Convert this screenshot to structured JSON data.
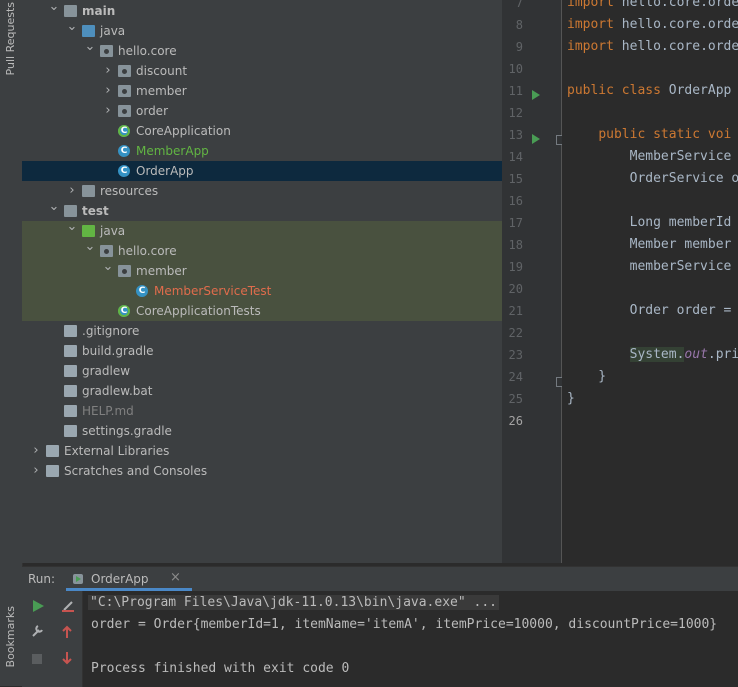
{
  "side_tabs": {
    "pull_requests": "Pull Requests",
    "bookmarks": "Bookmarks"
  },
  "tree": [
    {
      "label": "main",
      "icon": "folder-icon",
      "level": 2,
      "expanded": true,
      "style": "bold"
    },
    {
      "label": "java",
      "icon": "source-folder-icon",
      "level": 3,
      "expanded": true
    },
    {
      "label": "hello.core",
      "icon": "package-icon",
      "level": 4,
      "expanded": true
    },
    {
      "label": "discount",
      "icon": "package-icon",
      "level": 5,
      "expanded": false
    },
    {
      "label": "member",
      "icon": "package-icon",
      "level": 5,
      "expanded": false
    },
    {
      "label": "order",
      "icon": "package-icon",
      "level": 5,
      "expanded": false
    },
    {
      "label": "CoreApplication",
      "icon": "spring-class-icon",
      "level": 5
    },
    {
      "label": "MemberApp",
      "icon": "class-icon",
      "level": 5,
      "color": "#62b543"
    },
    {
      "label": "OrderApp",
      "icon": "class-icon",
      "level": 5,
      "selected": true
    },
    {
      "label": "resources",
      "icon": "resources-folder-icon",
      "level": 3,
      "expanded": false
    },
    {
      "label": "test",
      "icon": "folder-icon",
      "level": 2,
      "expanded": true,
      "style": "bold"
    },
    {
      "label": "java",
      "icon": "test-source-folder-icon",
      "level": 3,
      "expanded": true,
      "test": true
    },
    {
      "label": "hello.core",
      "icon": "package-icon",
      "level": 4,
      "expanded": true,
      "test": true
    },
    {
      "label": "member",
      "icon": "package-icon",
      "level": 5,
      "expanded": true,
      "test": true
    },
    {
      "label": "MemberServiceTest",
      "icon": "test-class-icon",
      "level": 6,
      "color": "#e06c4c",
      "test": true
    },
    {
      "label": "CoreApplicationTests",
      "icon": "spring-class-icon",
      "level": 5,
      "test": true
    },
    {
      "label": ".gitignore",
      "icon": "gitignore-file-icon",
      "level": 2
    },
    {
      "label": "build.gradle",
      "icon": "gradle-icon",
      "level": 2
    },
    {
      "label": "gradlew",
      "icon": "script-file-icon",
      "level": 2
    },
    {
      "label": "gradlew.bat",
      "icon": "text-file-icon",
      "level": 2
    },
    {
      "label": "HELP.md",
      "icon": "markdown-file-icon",
      "level": 2,
      "color": "#808080"
    },
    {
      "label": "settings.gradle",
      "icon": "gradle-icon",
      "level": 2
    },
    {
      "label": "External Libraries",
      "icon": "libraries-icon",
      "level": 1,
      "expanded": false
    },
    {
      "label": "Scratches and Consoles",
      "icon": "scratches-icon",
      "level": 1,
      "expanded": false
    }
  ],
  "editor": {
    "lines": [
      {
        "n": "7",
        "parts": [
          [
            "kw",
            "import "
          ],
          [
            "",
            "hello.core.orde"
          ]
        ]
      },
      {
        "n": "8",
        "parts": [
          [
            "kw",
            "import "
          ],
          [
            "",
            "hello.core.orde"
          ]
        ]
      },
      {
        "n": "9",
        "parts": [
          [
            "kw",
            "import "
          ],
          [
            "",
            "hello.core.orde"
          ]
        ]
      },
      {
        "n": "10",
        "parts": []
      },
      {
        "n": "11",
        "parts": [
          [
            "kw",
            "public class "
          ],
          [
            "",
            "OrderApp "
          ]
        ],
        "run": true
      },
      {
        "n": "12",
        "parts": []
      },
      {
        "n": "13",
        "parts": [
          [
            "",
            "    "
          ],
          [
            "kw",
            "public static voi"
          ]
        ],
        "run": true,
        "fold": true
      },
      {
        "n": "14",
        "parts": [
          [
            "",
            "        MemberService "
          ]
        ]
      },
      {
        "n": "15",
        "parts": [
          [
            "",
            "        OrderService o"
          ]
        ]
      },
      {
        "n": "16",
        "parts": []
      },
      {
        "n": "17",
        "parts": [
          [
            "",
            "        Long memberId "
          ]
        ]
      },
      {
        "n": "18",
        "parts": [
          [
            "",
            "        Member member "
          ]
        ]
      },
      {
        "n": "19",
        "parts": [
          [
            "",
            "        memberService"
          ]
        ]
      },
      {
        "n": "20",
        "parts": []
      },
      {
        "n": "21",
        "parts": [
          [
            "",
            "        Order order = "
          ]
        ]
      },
      {
        "n": "22",
        "parts": []
      },
      {
        "n": "23",
        "parts": [
          [
            "",
            "        "
          ],
          [
            "hl",
            "System."
          ],
          [
            "it",
            "out"
          ],
          [
            "",
            ".pri"
          ]
        ]
      },
      {
        "n": "24",
        "parts": [
          [
            "",
            "    }"
          ]
        ],
        "fold": true
      },
      {
        "n": "25",
        "parts": [
          [
            "",
            "}"
          ]
        ]
      },
      {
        "n": "26",
        "parts": [],
        "current": true
      }
    ]
  },
  "run": {
    "label": "Run:",
    "tab": "OrderApp",
    "console": [
      "\"C:\\Program Files\\Java\\jdk-11.0.13\\bin\\java.exe\" ...",
      "order = Order{memberId=1, itemName='itemA', itemPrice=10000, discountPrice=1000}",
      "",
      "Process finished with exit code 0"
    ]
  },
  "colors": {
    "accent": "#499c54",
    "selected_row": "#0d293e",
    "test_row": "#49513f"
  }
}
